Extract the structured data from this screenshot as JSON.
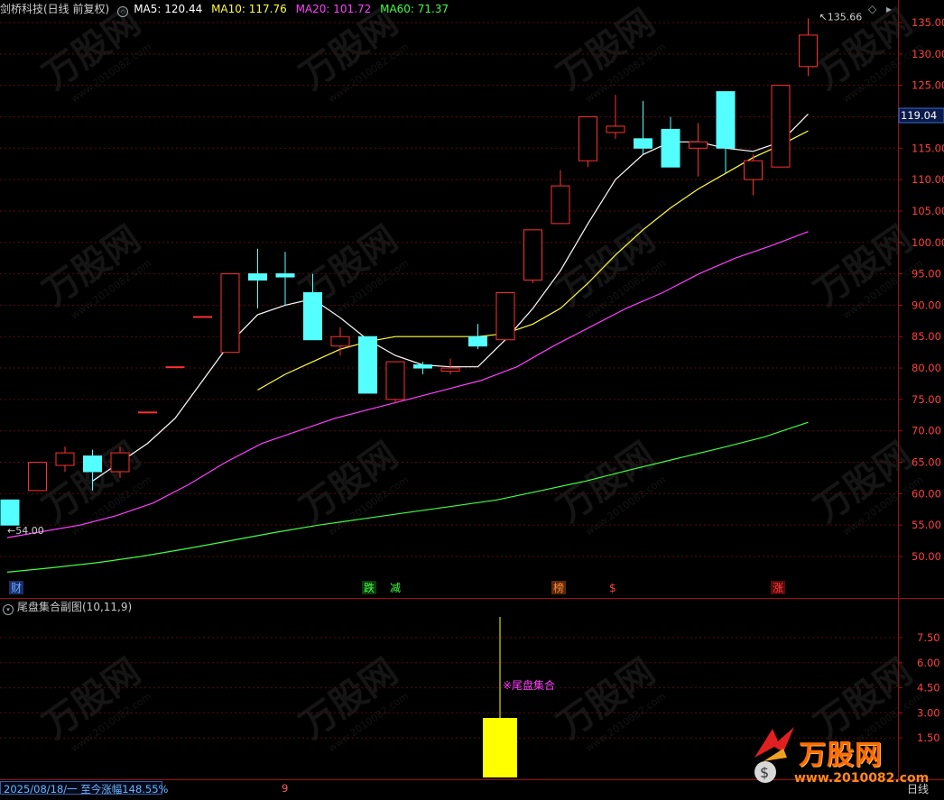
{
  "header": {
    "stock_title": "剑桥科技(日线 前复权)",
    "ma5": "MA5: 120.44",
    "ma10": "MA10: 117.76",
    "ma20": "MA20: 101.72",
    "ma60": "MA60: 71.37",
    "colors": {
      "title": "#cfcfcf",
      "ma5": "#ffffff",
      "ma10": "#ffff40",
      "ma20": "#ff40ff",
      "ma60": "#40ff40"
    }
  },
  "price_axis": {
    "labels": [
      "135.00",
      "130.00",
      "125.00",
      "120.00",
      "115.00",
      "110.00",
      "105.00",
      "100.00",
      "95.00",
      "90.00",
      "85.00",
      "80.00",
      "75.00",
      "70.00",
      "65.00",
      "60.00",
      "55.00",
      "50.00"
    ],
    "current_price_tag": "119.04",
    "high_label": "135.66",
    "low_label": "54.00"
  },
  "event_markers": [
    {
      "text": "财",
      "color": "#6fa8ff",
      "bg": "#1a2f6a"
    },
    {
      "text": "跌",
      "color": "#40ff40",
      "bg": "#0c3a0c"
    },
    {
      "text": "减",
      "color": "#40ff40",
      "bg": ""
    },
    {
      "text": "榜",
      "color": "#ff8a3a",
      "bg": "#5a2a0a"
    },
    {
      "text": "$",
      "color": "#ff4040",
      "bg": ""
    },
    {
      "text": "涨",
      "color": "#ff4040",
      "bg": "#5a0a0a"
    }
  ],
  "sub_chart": {
    "title": "尾盘集合副图(10,11,9)",
    "axis_labels": [
      "7.50",
      "6.00",
      "4.50",
      "3.00",
      "1.50"
    ],
    "signal_label": "※尾盘集合"
  },
  "status": {
    "date_text": "2025/08/18/一 至今涨幅148.55%",
    "count": "9",
    "period": "日线"
  },
  "watermark": {
    "brand": "万股网",
    "url": "www.2010082.com"
  },
  "chart_data": {
    "type": "candlestick",
    "ylim": [
      45,
      137
    ],
    "candles": [
      {
        "o": 59,
        "h": 59,
        "l": 55,
        "c": 55
      },
      {
        "o": 60.5,
        "h": 65,
        "l": 60.5,
        "c": 65
      },
      {
        "o": 64.5,
        "h": 67.5,
        "l": 63.5,
        "c": 66.5
      },
      {
        "o": 66,
        "h": 67,
        "l": 60.5,
        "c": 63.5
      },
      {
        "o": 63.5,
        "h": 67.5,
        "l": 62.5,
        "c": 66.5
      },
      {
        "o": 73,
        "h": 73,
        "l": 73,
        "c": 73
      },
      {
        "o": 80.2,
        "h": 80.2,
        "l": 80.2,
        "c": 80.2
      },
      {
        "o": 88.2,
        "h": 88.2,
        "l": 88.2,
        "c": 88.2
      },
      {
        "o": 82.5,
        "h": 95,
        "l": 82.5,
        "c": 95
      },
      {
        "o": 95,
        "h": 99,
        "l": 89.5,
        "c": 94
      },
      {
        "o": 95,
        "h": 98.5,
        "l": 90,
        "c": 94.5
      },
      {
        "o": 92,
        "h": 95,
        "l": 84.5,
        "c": 84.5
      },
      {
        "o": 83.5,
        "h": 86.5,
        "l": 82,
        "c": 85
      },
      {
        "o": 85,
        "h": 85,
        "l": 76,
        "c": 76
      },
      {
        "o": 75,
        "h": 81,
        "l": 74.5,
        "c": 81
      },
      {
        "o": 80.5,
        "h": 81,
        "l": 79,
        "c": 80
      },
      {
        "o": 79.5,
        "h": 81.5,
        "l": 79,
        "c": 80
      },
      {
        "o": 85,
        "h": 87,
        "l": 83,
        "c": 83.5
      },
      {
        "o": 84.5,
        "h": 92,
        "l": 84.5,
        "c": 92
      },
      {
        "o": 94,
        "h": 102,
        "l": 93.5,
        "c": 102
      },
      {
        "o": 103,
        "h": 111.5,
        "l": 103,
        "c": 109
      },
      {
        "o": 113,
        "h": 120,
        "l": 112,
        "c": 120
      },
      {
        "o": 117.5,
        "h": 123.5,
        "l": 116.5,
        "c": 118.5
      },
      {
        "o": 116.5,
        "h": 122.5,
        "l": 114,
        "c": 115
      },
      {
        "o": 118,
        "h": 120,
        "l": 112,
        "c": 112
      },
      {
        "o": 115,
        "h": 119,
        "l": 110.5,
        "c": 116
      },
      {
        "o": 124,
        "h": 124,
        "l": 111,
        "c": 115
      },
      {
        "o": 110,
        "h": 114,
        "l": 107.5,
        "c": 113
      },
      {
        "o": 112,
        "h": 125,
        "l": 112,
        "c": 125
      },
      {
        "o": 128,
        "h": 135.66,
        "l": 126.5,
        "c": 133
      }
    ],
    "ma5": [
      null,
      null,
      null,
      null,
      62,
      65,
      68,
      72,
      78,
      84,
      88.5,
      90,
      91,
      88,
      84.5,
      82,
      80.5,
      80.2,
      80.2,
      84.5,
      89.5,
      95.5,
      103,
      110,
      114,
      116,
      116,
      115,
      114.5,
      116,
      120.44
    ],
    "ma10": [
      null,
      null,
      null,
      null,
      null,
      null,
      null,
      null,
      null,
      null,
      76.5,
      79,
      81,
      83,
      84.2,
      85,
      85,
      85,
      85,
      85.5,
      87,
      89.5,
      93.5,
      98,
      102,
      105.5,
      108.5,
      111,
      113.5,
      115.5,
      117.76
    ],
    "ma20": [
      53,
      54,
      55,
      56.5,
      58.5,
      61.5,
      65,
      68,
      70,
      72,
      73.5,
      75,
      76.5,
      78,
      80.2,
      83.5,
      86.5,
      89.5,
      92,
      95,
      97.5,
      99.5,
      101.72
    ],
    "ma60": [
      47.5,
      48.2,
      49,
      50,
      51.2,
      52.5,
      53.8,
      55,
      56,
      57,
      58,
      59,
      60.5,
      62,
      63.8,
      65.5,
      67.2,
      69,
      71.37
    ]
  }
}
